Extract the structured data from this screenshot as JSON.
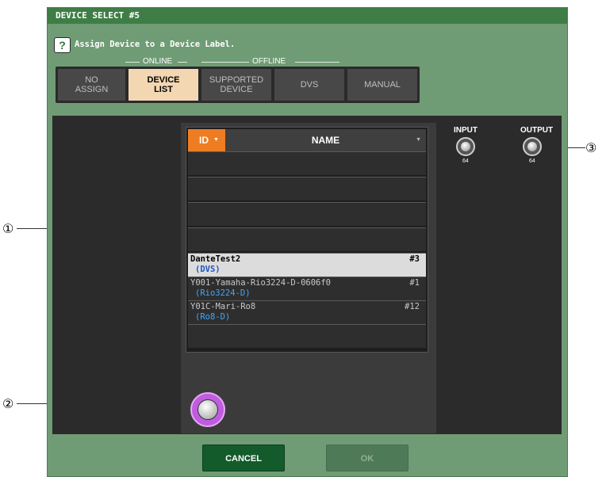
{
  "window": {
    "title": "DEVICE SELECT #5"
  },
  "instruction": "Assign Device to a Device Label.",
  "groups": {
    "online": "ONLINE",
    "offline": "OFFLINE"
  },
  "tabs": [
    {
      "label": "NO\nASSIGN",
      "active": false
    },
    {
      "label": "DEVICE\nLIST",
      "active": true
    },
    {
      "label": "SUPPORTED\nDEVICE",
      "active": false
    },
    {
      "label": "DVS",
      "active": false
    },
    {
      "label": "MANUAL",
      "active": false
    }
  ],
  "list": {
    "headers": {
      "id": "ID",
      "name": "NAME"
    },
    "rows": [
      {
        "name": "DanteTest2",
        "type": "(DVS)",
        "id": "#3",
        "selected": true
      },
      {
        "name": "Y001-Yamaha-Rio3224-D-0606f0",
        "type": "(Rio3224-D)",
        "id": "#1",
        "selected": false
      },
      {
        "name": "Y01C-Mari-Ro8",
        "type": "(Ro8-D)",
        "id": "#12",
        "selected": false
      }
    ]
  },
  "io": {
    "input_label": "INPUT",
    "output_label": "OUTPUT",
    "input_value": "64",
    "output_value": "64"
  },
  "buttons": {
    "cancel": "CANCEL",
    "ok": "OK"
  },
  "callouts": {
    "c1": "①",
    "c2": "②",
    "c3": "③"
  },
  "icons": {
    "help": "question-icon"
  },
  "colors": {
    "accent_orange": "#ee7d22",
    "selected_tab": "#f3d7b2",
    "cancel_green": "#145b2b",
    "knob_purple": "#c05ce0"
  }
}
